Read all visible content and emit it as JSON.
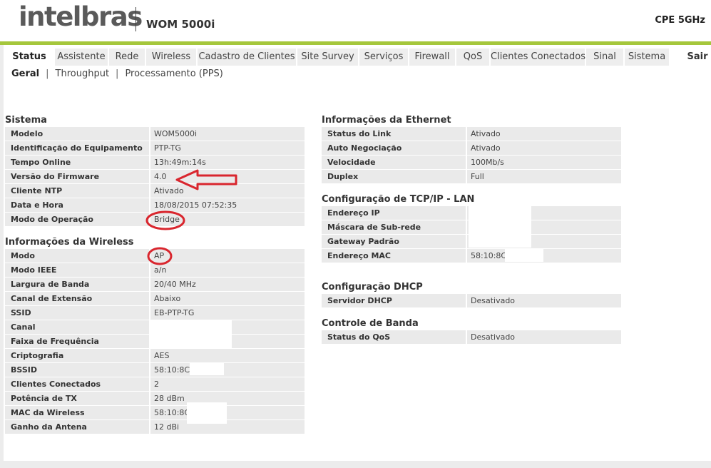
{
  "header": {
    "logo": "intelbras",
    "model": "WOM 5000i",
    "cpe": "CPE 5GHz"
  },
  "tabs": [
    "Status",
    "Assistente",
    "Rede",
    "Wireless",
    "Cadastro de Clientes",
    "Site Survey",
    "Serviços",
    "Firewall",
    "QoS",
    "Clientes Conectados",
    "Sinal",
    "Sistema"
  ],
  "logout": "Sair",
  "subnav": {
    "items": [
      "Geral",
      "Throughput",
      "Processamento (PPS)"
    ],
    "separator": "|"
  },
  "sistema": {
    "title": "Sistema",
    "rows": [
      {
        "label": "Modelo",
        "value": "WOM5000i"
      },
      {
        "label": "Identificação do Equipamento",
        "value": "PTP-TG"
      },
      {
        "label": "Tempo Online",
        "value": "13h:49m:14s"
      },
      {
        "label": "Versão do Firmware",
        "value": "4.0"
      },
      {
        "label": "Cliente NTP",
        "value": "Ativado"
      },
      {
        "label": "Data e Hora",
        "value": "18/08/2015 07:52:35"
      },
      {
        "label": "Modo de Operação",
        "value": "Bridge"
      }
    ]
  },
  "wireless": {
    "title": "Informações da Wireless",
    "rows": [
      {
        "label": "Modo",
        "value": "AP"
      },
      {
        "label": "Modo IEEE",
        "value": "a/n"
      },
      {
        "label": "Largura de Banda",
        "value": "20/40 MHz"
      },
      {
        "label": "Canal de Extensão",
        "value": "Abaixo"
      },
      {
        "label": "SSID",
        "value": "EB-PTP-TG"
      },
      {
        "label": "Canal",
        "value": ""
      },
      {
        "label": "Faixa de Frequência",
        "value": ""
      },
      {
        "label": "Criptografia",
        "value": "AES"
      },
      {
        "label": "BSSID",
        "value": "58:10:8C:"
      },
      {
        "label": "Clientes Conectados",
        "value": "2"
      },
      {
        "label": "Potência de TX",
        "value": "28 dBm"
      },
      {
        "label": "MAC da Wireless",
        "value": "58:10:8C"
      },
      {
        "label": "Ganho da Antena",
        "value": "12 dBi"
      }
    ]
  },
  "ethernet": {
    "title": "Informações da Ethernet",
    "rows": [
      {
        "label": "Status do Link",
        "value": "Ativado"
      },
      {
        "label": "Auto Negociação",
        "value": "Ativado"
      },
      {
        "label": "Velocidade",
        "value": "100Mb/s"
      },
      {
        "label": "Duplex",
        "value": "Full"
      }
    ]
  },
  "tcpip": {
    "title": "Configuração de TCP/IP - LAN",
    "rows": [
      {
        "label": "Endereço IP",
        "value": ""
      },
      {
        "label": "Máscara de Sub-rede",
        "value": ""
      },
      {
        "label": "Gateway Padrão",
        "value": ""
      },
      {
        "label": "Endereço MAC",
        "value": "58:10:8C:"
      }
    ]
  },
  "dhcp": {
    "title": "Configuração DHCP",
    "rows": [
      {
        "label": "Servidor DHCP",
        "value": "Desativado"
      }
    ]
  },
  "banda": {
    "title": "Controle de Banda",
    "rows": [
      {
        "label": "Status do QoS",
        "value": "Desativado"
      }
    ]
  },
  "colors": {
    "accent_green": "#a5c73c",
    "annotation_red": "#d9262e",
    "row_bg": "#eaeaea"
  }
}
